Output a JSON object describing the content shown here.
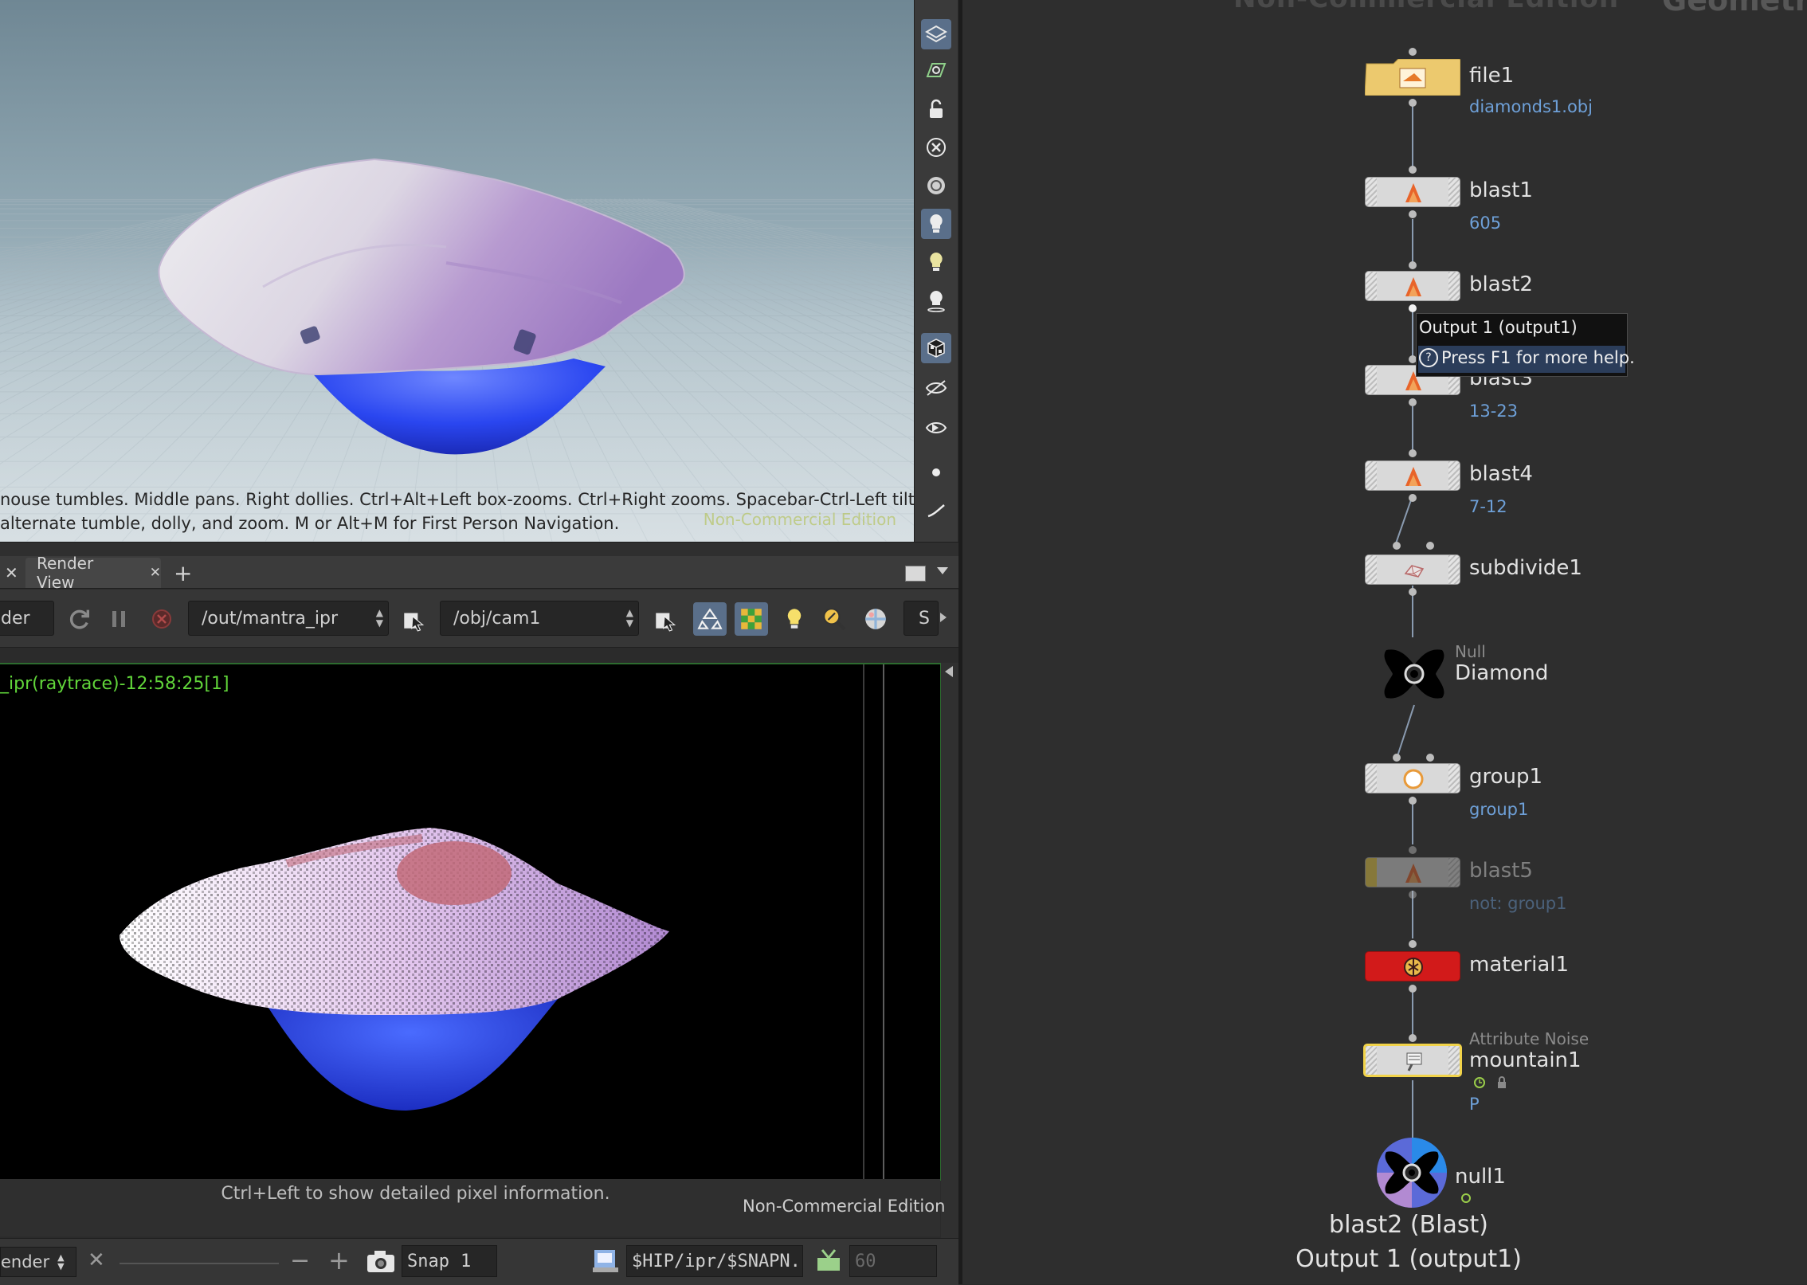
{
  "viewport": {
    "help_line1": "nouse tumbles. Middle pans. Right dollies. Ctrl+Alt+Left box-zooms. Ctrl+Right zooms. Spacebar-Ctrl-Left tilts. Hold",
    "help_line2": "alternate tumble, dolly, and zoom.    M or Alt+M for First Person Navigation.",
    "watermark": "Non-Commercial Edition",
    "toolbar_icons": [
      "display-options-icon",
      "snapping-icon",
      "lock-camera-icon",
      "remove-icon",
      "shading-icon",
      "light-icon",
      "light-bulb-icon",
      "add-light-icon",
      "checker-icon",
      "view-eye-icon",
      "camera-eye-icon",
      "dot-icon",
      "pen-icon"
    ]
  },
  "render_view": {
    "tab_label": "Render View",
    "tab_close": "✕",
    "left_close": "✕",
    "add_tab": "+",
    "render_label": "der",
    "rop_path": "/out/mantra_ipr",
    "camera_path": "/obj/cam1",
    "trailing_label": "S",
    "image_title": "_ipr(raytrace)-12:58:25[1]",
    "hint": "Ctrl+Left to show detailed pixel information.",
    "watermark": "Non-Commercial Edition",
    "bottom": {
      "render_label": "ender",
      "snap_label": "Snap",
      "snap_value": "1",
      "path": "$HIP/ipr/$SNAPN.",
      "frames": "60"
    }
  },
  "network": {
    "watermark": "Non-Commercial Edition",
    "context": "Geometr",
    "tooltip": {
      "line1": "Output 1 (output1)",
      "line2": "Press F1 for more help.",
      "help_glyph": "?"
    },
    "nodes": [
      {
        "name": "file1",
        "sub": "diamonds1.obj",
        "type": ""
      },
      {
        "name": "blast1",
        "sub": "605",
        "type": ""
      },
      {
        "name": "blast2",
        "sub": "",
        "type": ""
      },
      {
        "name": "blast3",
        "sub": "13-23",
        "type": ""
      },
      {
        "name": "blast4",
        "sub": "7-12",
        "type": ""
      },
      {
        "name": "subdivide1",
        "sub": "",
        "type": ""
      },
      {
        "name": "Diamond",
        "sub": "",
        "type": "Null"
      },
      {
        "name": "group1",
        "sub": "group1",
        "type": ""
      },
      {
        "name": "blast5",
        "sub": "not: group1",
        "type": ""
      },
      {
        "name": "material1",
        "sub": "",
        "type": ""
      },
      {
        "name": "mountain1",
        "sub": "P",
        "type": "Attribute Noise"
      },
      {
        "name": "null1",
        "sub": "",
        "type": ""
      }
    ],
    "info_line1": "blast2 (Blast)",
    "info_line2": "Output 1 (output1)"
  },
  "colors": {
    "accent_blue": "#6ea0d8",
    "ipr_title_green": "#61d63a",
    "material_red": "#d21a1a",
    "file_yellow": "#ecc96e",
    "selected_yellow": "#f1d34a"
  }
}
